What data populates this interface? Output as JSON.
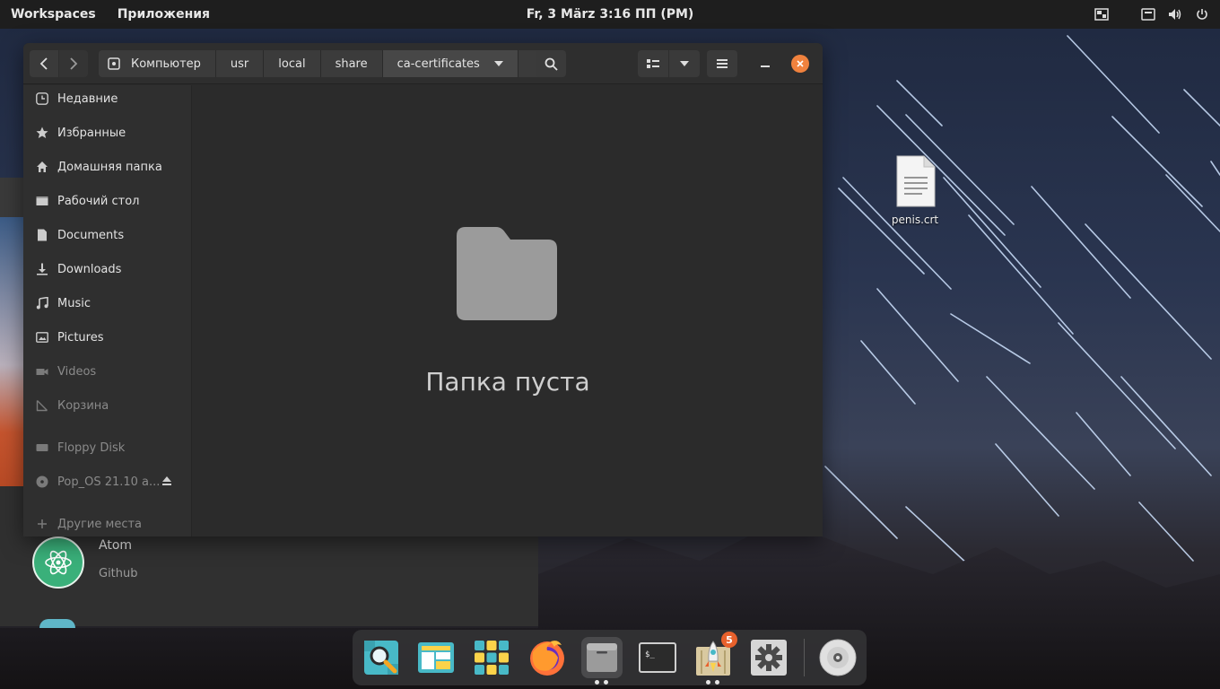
{
  "topbar": {
    "workspaces": "Workspaces",
    "applications": "Приложения",
    "clock": "Fr, 3 März   3:16 ПП (PM)"
  },
  "filemanager": {
    "path": [
      "Компьютер",
      "usr",
      "local",
      "share",
      "ca-certificates"
    ],
    "sidebar": [
      {
        "label": "Недавние",
        "icon": "clock-icon",
        "enabled": true
      },
      {
        "label": "Избранные",
        "icon": "star-icon",
        "enabled": true
      },
      {
        "label": "Домашняя папка",
        "icon": "home-icon",
        "enabled": true
      },
      {
        "label": "Рабочий стол",
        "icon": "desktop-icon",
        "enabled": true
      },
      {
        "label": "Documents",
        "icon": "document-icon",
        "enabled": true
      },
      {
        "label": "Downloads",
        "icon": "download-icon",
        "enabled": true
      },
      {
        "label": "Music",
        "icon": "music-icon",
        "enabled": true
      },
      {
        "label": "Pictures",
        "icon": "picture-icon",
        "enabled": true
      },
      {
        "label": "Videos",
        "icon": "video-icon",
        "enabled": false
      },
      {
        "label": "Корзина",
        "icon": "trash-icon",
        "enabled": false
      },
      {
        "label": "Floppy Disk",
        "icon": "drive-icon",
        "enabled": false
      },
      {
        "label": "Pop_OS 21.10 a...",
        "icon": "disc-icon",
        "enabled": false
      },
      {
        "label": "Другие места",
        "icon": "plus-icon",
        "enabled": false
      }
    ],
    "empty_message": "Папка пуста"
  },
  "background_app": {
    "item_name": "Atom",
    "item_sub": "Github"
  },
  "desktop": {
    "file_label": "penis.crt"
  },
  "dock": {
    "badge_count": "5",
    "items": [
      "search-app-icon",
      "workspaces-icon",
      "app-grid-icon",
      "firefox-icon",
      "files-icon",
      "terminal-icon",
      "pop-shop-icon",
      "settings-icon",
      "disc-drive-icon"
    ]
  },
  "colors": {
    "accent": "#f0823e",
    "window_bg": "#2b2b2b",
    "sidebar_bg": "#2f2f2f",
    "topbar_bg": "#1e1e1e"
  }
}
